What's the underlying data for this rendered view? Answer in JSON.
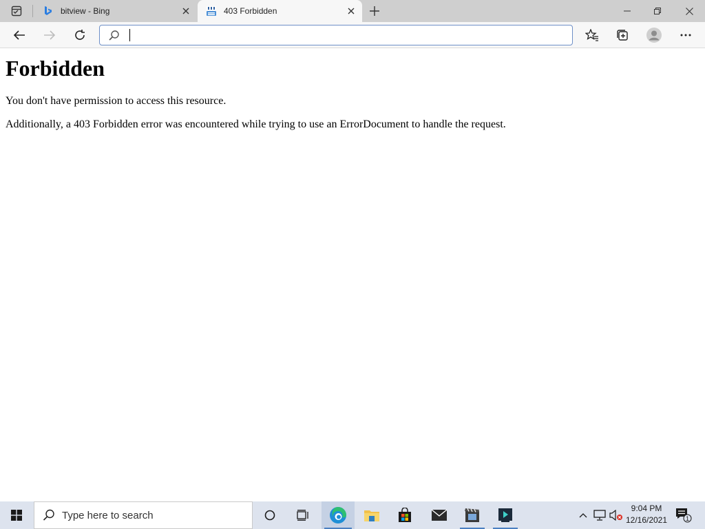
{
  "browser": {
    "tabs": [
      {
        "title": "bitview - Bing",
        "favicon": "bing-icon",
        "active": false
      },
      {
        "title": "403 Forbidden",
        "favicon": "bitview-icon",
        "active": true
      }
    ],
    "address_bar": {
      "value": "",
      "placeholder": ""
    }
  },
  "page": {
    "heading": "Forbidden",
    "paragraphs": [
      "You don't have permission to access this resource.",
      "Additionally, a 403 Forbidden error was encountered while trying to use an ErrorDocument to handle the request."
    ]
  },
  "taskbar": {
    "search_placeholder": "Type here to search",
    "apps": [
      "edge-icon",
      "file-explorer-icon",
      "store-icon",
      "mail-icon",
      "movie-maker-icon",
      "app-icon"
    ],
    "active_apps": [
      "edge-icon",
      "movie-maker-icon",
      "app-icon"
    ],
    "clock": {
      "time": "9:04 PM",
      "date": "12/16/2021"
    },
    "notification_count": "1"
  },
  "colors": {
    "tab_strip": "#cfcfcf",
    "toolbar": "#f7f7f7",
    "address_border": "#6d8fc7",
    "taskbar": "#dde3ee"
  }
}
